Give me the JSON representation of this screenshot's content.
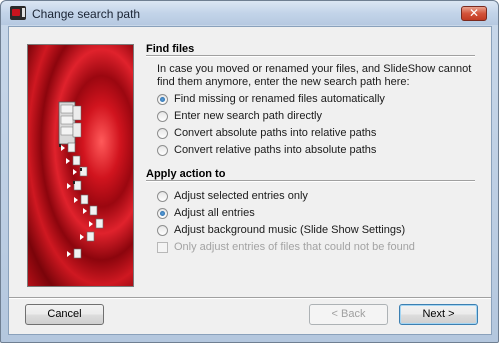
{
  "window": {
    "title": "Change search path",
    "close_symbol": "✕"
  },
  "find_files": {
    "heading": "Find files",
    "description": "In case you moved or renamed your files, and SlideShow cannot find them anymore, enter the new search path here:",
    "options": [
      {
        "label": "Find missing or renamed files automatically",
        "selected": true
      },
      {
        "label": "Enter new search path directly",
        "selected": false
      },
      {
        "label": "Convert absolute paths into relative paths",
        "selected": false
      },
      {
        "label": "Convert relative paths into absolute paths",
        "selected": false
      }
    ]
  },
  "apply_action": {
    "heading": "Apply action to",
    "options": [
      {
        "label": "Adjust selected entries only",
        "selected": false
      },
      {
        "label": "Adjust all entries",
        "selected": true
      },
      {
        "label": "Adjust background music (Slide Show Settings)",
        "selected": false
      }
    ],
    "checkbox": {
      "label": "Only adjust entries of files that could not be found",
      "checked": false,
      "enabled": false
    }
  },
  "buttons": {
    "cancel": "Cancel",
    "back": "< Back",
    "next": "Next >"
  },
  "icons": {
    "app": "slideshow-app-icon",
    "close": "close-icon",
    "folder_tree": "folder-tree-illustration"
  },
  "colors": {
    "side_panel_red": "#c8141e",
    "close_button": "#c13a22"
  }
}
